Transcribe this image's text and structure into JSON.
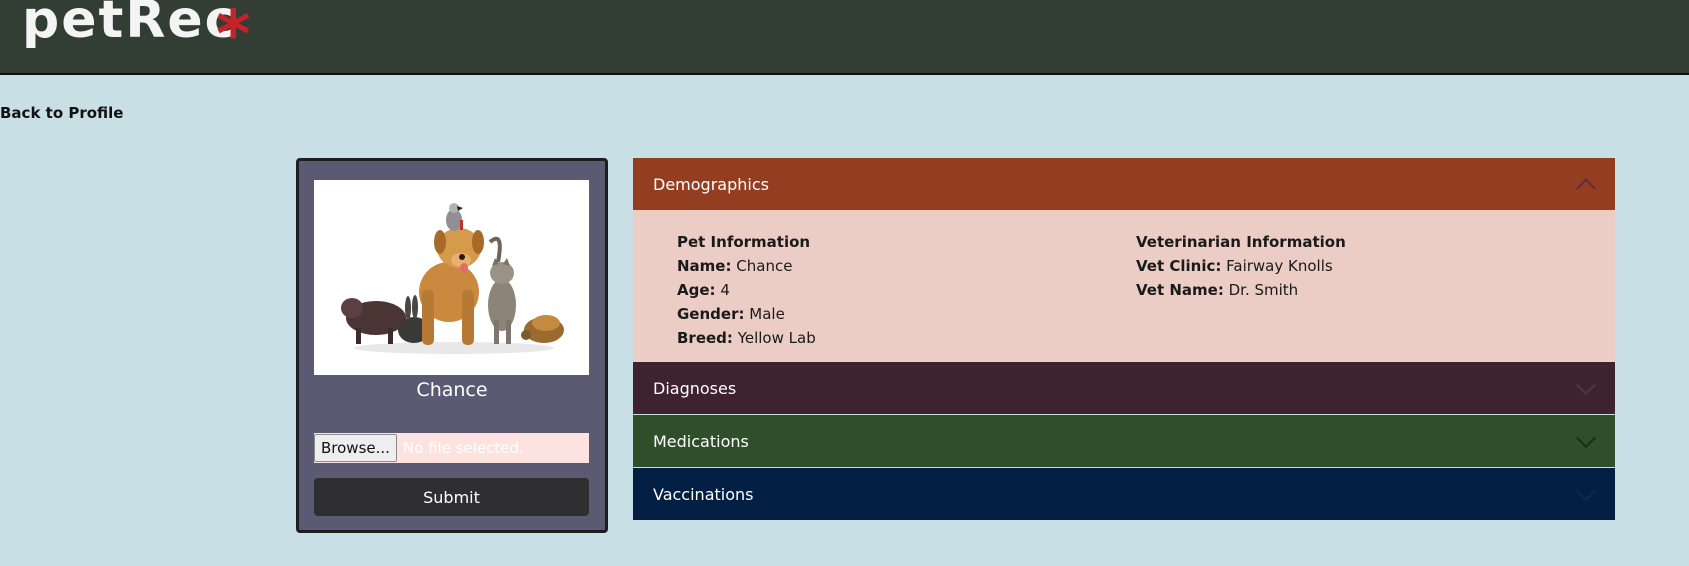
{
  "header": {
    "brand": "petRec",
    "brand_mark": "*"
  },
  "nav": {
    "back_label": "Back to Profile"
  },
  "profile": {
    "pet_name": "Chance",
    "photo_alt": "pets",
    "browse_label": "Browse...",
    "file_status": "No file selected.",
    "submit_label": "Submit"
  },
  "accordion": {
    "demographics": {
      "title": "Demographics",
      "expanded": true,
      "pet_info": {
        "heading": "Pet Information",
        "name_label": "Name:",
        "name": "Chance",
        "age_label": "Age:",
        "age": "4",
        "gender_label": "Gender:",
        "gender": "Male",
        "breed_label": "Breed:",
        "breed": "Yellow Lab"
      },
      "vet_info": {
        "heading": "Veterinarian Information",
        "clinic_label": "Vet Clinic:",
        "clinic": "Fairway Knolls",
        "vet_name_label": "Vet Name:",
        "vet_name": "Dr. Smith"
      }
    },
    "diagnoses": {
      "title": "Diagnoses",
      "expanded": false
    },
    "medications": {
      "title": "Medications",
      "expanded": false
    },
    "vaccinations": {
      "title": "Vaccinations",
      "expanded": false
    }
  },
  "colors": {
    "page_bg": "#c8dfe6",
    "header_bg": "#323d33",
    "brand_mark": "#c5222a",
    "card_bg": "#5c5973",
    "demographics": "#933e21",
    "demographics_body": "#ebcdc6",
    "diagnoses": "#3e232f",
    "medications": "#2f4f2b",
    "vaccinations": "#032044"
  }
}
